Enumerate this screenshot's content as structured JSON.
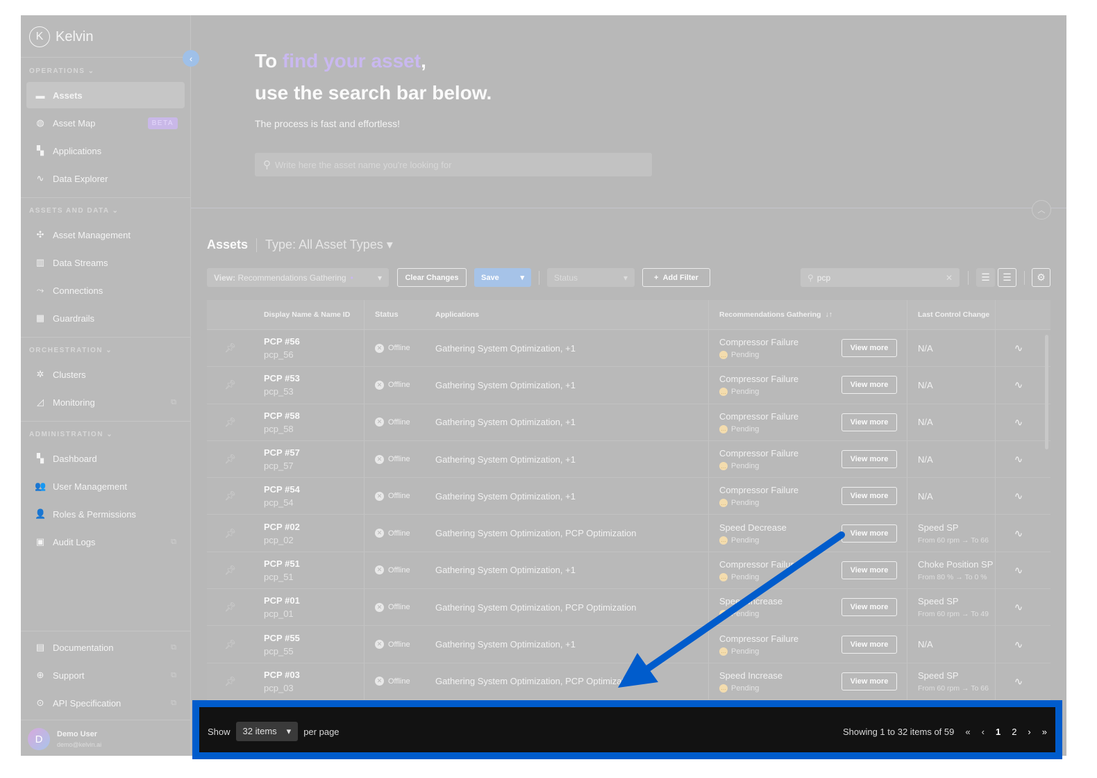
{
  "brand": "Kelvin",
  "sidebar": {
    "sections": [
      {
        "title": "OPERATIONS ⌄",
        "items": [
          {
            "label": "Assets",
            "icon": "assets-icon"
          },
          {
            "label": "Asset Map",
            "icon": "globe-icon",
            "badge": "BETA"
          },
          {
            "label": "Applications",
            "icon": "applications-icon"
          },
          {
            "label": "Data Explorer",
            "icon": "pulse-icon"
          }
        ]
      },
      {
        "title": "ASSETS AND DATA ⌄",
        "items": [
          {
            "label": "Asset Management"
          },
          {
            "label": "Data Streams"
          },
          {
            "label": "Connections"
          },
          {
            "label": "Guardrails"
          }
        ]
      },
      {
        "title": "ORCHESTRATION ⌄",
        "items": [
          {
            "label": "Clusters"
          },
          {
            "label": "Monitoring"
          }
        ]
      },
      {
        "title": "ADMINISTRATION ⌄",
        "items": [
          {
            "label": "Dashboard"
          },
          {
            "label": "User Management"
          },
          {
            "label": "Roles & Permissions"
          },
          {
            "label": "Audit Logs"
          }
        ]
      }
    ],
    "bottom": [
      {
        "label": "Documentation"
      },
      {
        "label": "Support"
      },
      {
        "label": "API Specification"
      }
    ],
    "user": {
      "initial": "D",
      "name": "Demo User",
      "email": "demo@kelvin.ai"
    }
  },
  "hero": {
    "pre": "To ",
    "accent": "find your asset",
    "post": ",",
    "line2": "use the search bar below.",
    "sub": "The process is fast and effortless!",
    "placeholder": "Write here the asset name you're looking for"
  },
  "toolbar": {
    "title": "Assets",
    "type": "Type: All Asset Types ▾",
    "view_label": "View:",
    "view_value": "Recommendations Gathering",
    "clear": "Clear Changes",
    "save": "Save",
    "status": "Status",
    "add_filter": "Add Filter",
    "search": "pcp"
  },
  "table": {
    "headers": [
      "Display Name & Name ID",
      "Status",
      "Applications",
      "Recommendations Gathering",
      "Last Control Change"
    ],
    "view_more": "View more",
    "rows": [
      {
        "name": "PCP #56",
        "id": "pcp_56",
        "status": "Offline",
        "apps": "Gathering System Optimization, +1",
        "rec": "Compressor Failure",
        "rec_status": "Pending",
        "lcc": "N/A",
        "lcc_sub": ""
      },
      {
        "name": "PCP #53",
        "id": "pcp_53",
        "status": "Offline",
        "apps": "Gathering System Optimization, +1",
        "rec": "Compressor Failure",
        "rec_status": "Pending",
        "lcc": "N/A",
        "lcc_sub": ""
      },
      {
        "name": "PCP #58",
        "id": "pcp_58",
        "status": "Offline",
        "apps": "Gathering System Optimization, +1",
        "rec": "Compressor Failure",
        "rec_status": "Pending",
        "lcc": "N/A",
        "lcc_sub": ""
      },
      {
        "name": "PCP #57",
        "id": "pcp_57",
        "status": "Offline",
        "apps": "Gathering System Optimization, +1",
        "rec": "Compressor Failure",
        "rec_status": "Pending",
        "lcc": "N/A",
        "lcc_sub": ""
      },
      {
        "name": "PCP #54",
        "id": "pcp_54",
        "status": "Offline",
        "apps": "Gathering System Optimization, +1",
        "rec": "Compressor Failure",
        "rec_status": "Pending",
        "lcc": "N/A",
        "lcc_sub": ""
      },
      {
        "name": "PCP #02",
        "id": "pcp_02",
        "status": "Offline",
        "apps": "Gathering System Optimization, PCP Optimization",
        "rec": "Speed Decrease",
        "rec_status": "Pending",
        "lcc": "Speed SP",
        "lcc_sub": "From 60 rpm → To 66"
      },
      {
        "name": "PCP #51",
        "id": "pcp_51",
        "status": "Offline",
        "apps": "Gathering System Optimization, +1",
        "rec": "Compressor Failure",
        "rec_status": "Pending",
        "lcc": "Choke Position SP",
        "lcc_sub": "From 80 % → To 0 %"
      },
      {
        "name": "PCP #01",
        "id": "pcp_01",
        "status": "Offline",
        "apps": "Gathering System Optimization, PCP Optimization",
        "rec": "Speed Increase",
        "rec_status": "Pending",
        "lcc": "Speed SP",
        "lcc_sub": "From 60 rpm → To 49"
      },
      {
        "name": "PCP #55",
        "id": "pcp_55",
        "status": "Offline",
        "apps": "Gathering System Optimization, +1",
        "rec": "Compressor Failure",
        "rec_status": "Pending",
        "lcc": "N/A",
        "lcc_sub": ""
      },
      {
        "name": "PCP #03",
        "id": "pcp_03",
        "status": "Offline",
        "apps": "Gathering System Optimization, PCP Optimization",
        "rec": "Speed Increase",
        "rec_status": "Pending",
        "lcc": "Speed SP",
        "lcc_sub": "From 60 rpm → To 66"
      }
    ]
  },
  "pager": {
    "show": "Show",
    "per_page_value": "32 items",
    "per_page": "per page",
    "summary": "Showing 1 to 32 items of 59",
    "pages": [
      "1",
      "2"
    ]
  },
  "colors": {
    "highlight": "#005ccc",
    "accent": "#c9b8f0"
  }
}
